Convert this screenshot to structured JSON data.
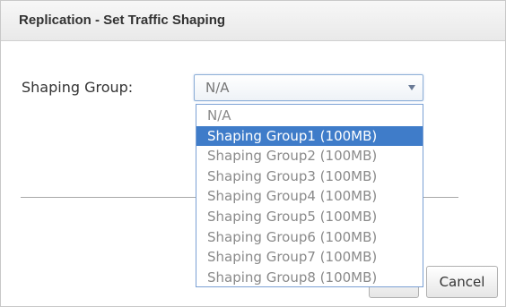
{
  "dialog": {
    "title": "Replication - Set Traffic Shaping"
  },
  "form": {
    "shaping_group_label": "Shaping Group:",
    "shaping_group_value": "N/A",
    "options": [
      "N/A",
      "Shaping Group1 (100MB)",
      "Shaping Group2 (100MB)",
      "Shaping Group3 (100MB)",
      "Shaping Group4 (100MB)",
      "Shaping Group5 (100MB)",
      "Shaping Group6 (100MB)",
      "Shaping Group7 (100MB)",
      "Shaping Group8 (100MB)"
    ],
    "highlighted_option": "Shaping Group1 (100MB)"
  },
  "buttons": {
    "ok_label": "",
    "cancel_label": "Cancel"
  },
  "colors": {
    "highlight": "#3f7cc9",
    "dropdown_border": "#7aa0d4",
    "title_bar": "#eeeeee"
  },
  "icons": {
    "select_arrow": "chevron-down-icon"
  }
}
